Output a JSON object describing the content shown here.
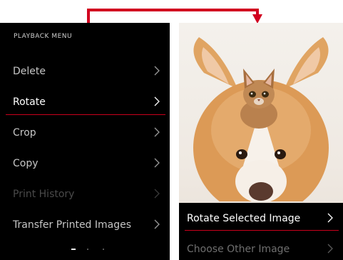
{
  "menu": {
    "title": "PLAYBACK MENU",
    "items": [
      {
        "label": "Delete"
      },
      {
        "label": "Rotate"
      },
      {
        "label": "Crop"
      },
      {
        "label": "Copy"
      },
      {
        "label": "Print History"
      },
      {
        "label": "Transfer Printed Images"
      }
    ]
  },
  "submenu": {
    "items": [
      {
        "label": "Rotate Selected Image"
      },
      {
        "label": "Choose Other Image"
      }
    ]
  },
  "colors": {
    "accent": "#c8001c",
    "panel_bg": "#000000"
  },
  "icons": {
    "arrow": "flow-arrow-icon",
    "chevron": "chevron-right-icon"
  }
}
